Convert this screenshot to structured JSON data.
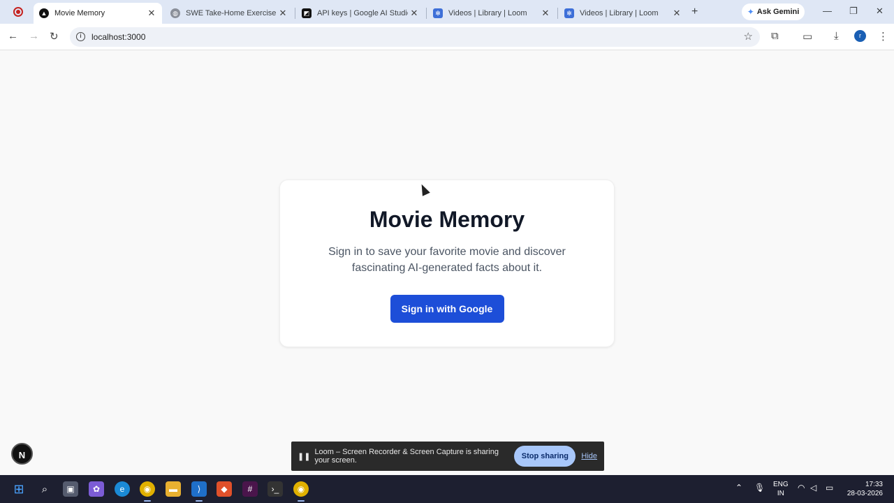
{
  "browser": {
    "tabs": [
      {
        "title": "Movie Memory",
        "active": true
      },
      {
        "title": "SWE Take-Home Exercise (Fu",
        "active": false
      },
      {
        "title": "API keys | Google AI Studio",
        "active": false
      },
      {
        "title": "Videos | Library | Loom",
        "active": false
      },
      {
        "title": "Videos | Library | Loom",
        "active": false
      }
    ],
    "new_tab_label": "+",
    "gemini_label": "Ask Gemini",
    "url": "localhost:3000",
    "profile_initial": "r"
  },
  "page": {
    "title": "Movie Memory",
    "subtitle": "Sign in to save your favorite movie and discover fascinating AI-generated facts about it.",
    "signin_label": "Sign in with Google",
    "dev_badge": "N"
  },
  "loom": {
    "message": "Loom – Screen Recorder & Screen Capture is sharing your screen.",
    "stop_label": "Stop sharing",
    "hide_label": "Hide"
  },
  "taskbar": {
    "lang_line1": "ENG",
    "lang_line2": "IN",
    "time": "17:33",
    "date": "28-03-2026"
  },
  "colors": {
    "accent": "#1d4ed8",
    "tabstrip": "#dfe7f5",
    "taskbar": "#1d1f30"
  }
}
